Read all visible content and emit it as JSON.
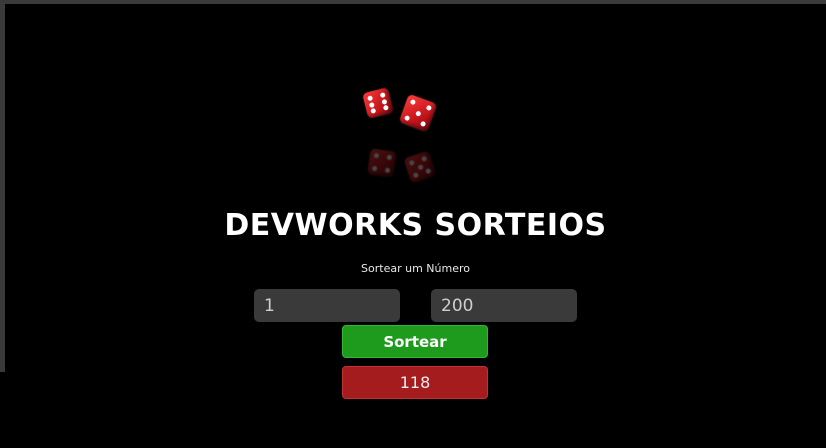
{
  "header": {
    "title": "DEVWORKS SORTEIOS",
    "subtitle": "Sortear um Número"
  },
  "logo": {
    "icon": "dice-icon",
    "color": "#d61c22"
  },
  "form": {
    "min_value": "1",
    "max_value": "200",
    "draw_button_label": "Sortear",
    "result_value": "118"
  },
  "colors": {
    "background": "#000000",
    "draw_button": "#1e9b1c",
    "result_box": "#a51c1e",
    "input_bg": "#3a3a3a"
  }
}
